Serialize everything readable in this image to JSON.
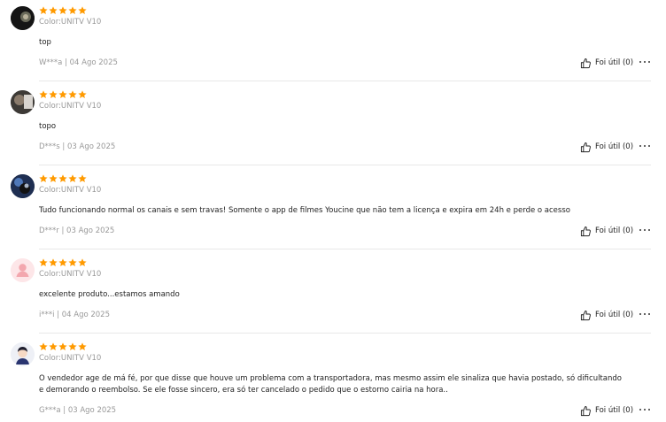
{
  "colors": {
    "star": "#ff9a00",
    "muted": "#999999",
    "text": "#222222",
    "divider": "#e8e8e8"
  },
  "icons": {
    "rating": "star-icon",
    "helpful": "thumbs-up-icon",
    "more": "more-icon"
  },
  "reviews": [
    {
      "rating": 5,
      "avatar": "photo",
      "color": "Color:UNITV V10",
      "text": "top",
      "meta": "W***a | 04 Ago 2025",
      "helpful": "Foi útil (0)"
    },
    {
      "rating": 5,
      "avatar": "photo",
      "color": "Color:UNITV V10",
      "text": "topo",
      "meta": "D***s | 03 Ago 2025",
      "helpful": "Foi útil (0)"
    },
    {
      "rating": 5,
      "avatar": "photo",
      "color": "Color:UNITV V10",
      "text": "Tudo funcionando normal os canais e sem travas! Somente o app de filmes Youcine que não tem a licença e expira em 24h e perde o acesso",
      "meta": "D***r | 03 Ago 2025",
      "helpful": "Foi útil (0)"
    },
    {
      "rating": 5,
      "avatar": "default-user",
      "color": "Color:UNITV V10",
      "text": "excelente produto...estamos amando",
      "meta": "i***i | 04 Ago 2025",
      "helpful": "Foi útil (0)"
    },
    {
      "rating": 5,
      "avatar": "cartoon",
      "color": "Color:UNITV V10",
      "text": "O vendedor age de má fé, por que disse que houve um problema com a transportadora, mas mesmo assim ele sinaliza que havia postado, só dificultando e demorando o reembolso. Se ele fosse sincero, era só ter cancelado o pedido que o estorno cairia na hora..",
      "meta": "G***a | 03 Ago 2025",
      "helpful": "Foi útil (0)"
    }
  ]
}
